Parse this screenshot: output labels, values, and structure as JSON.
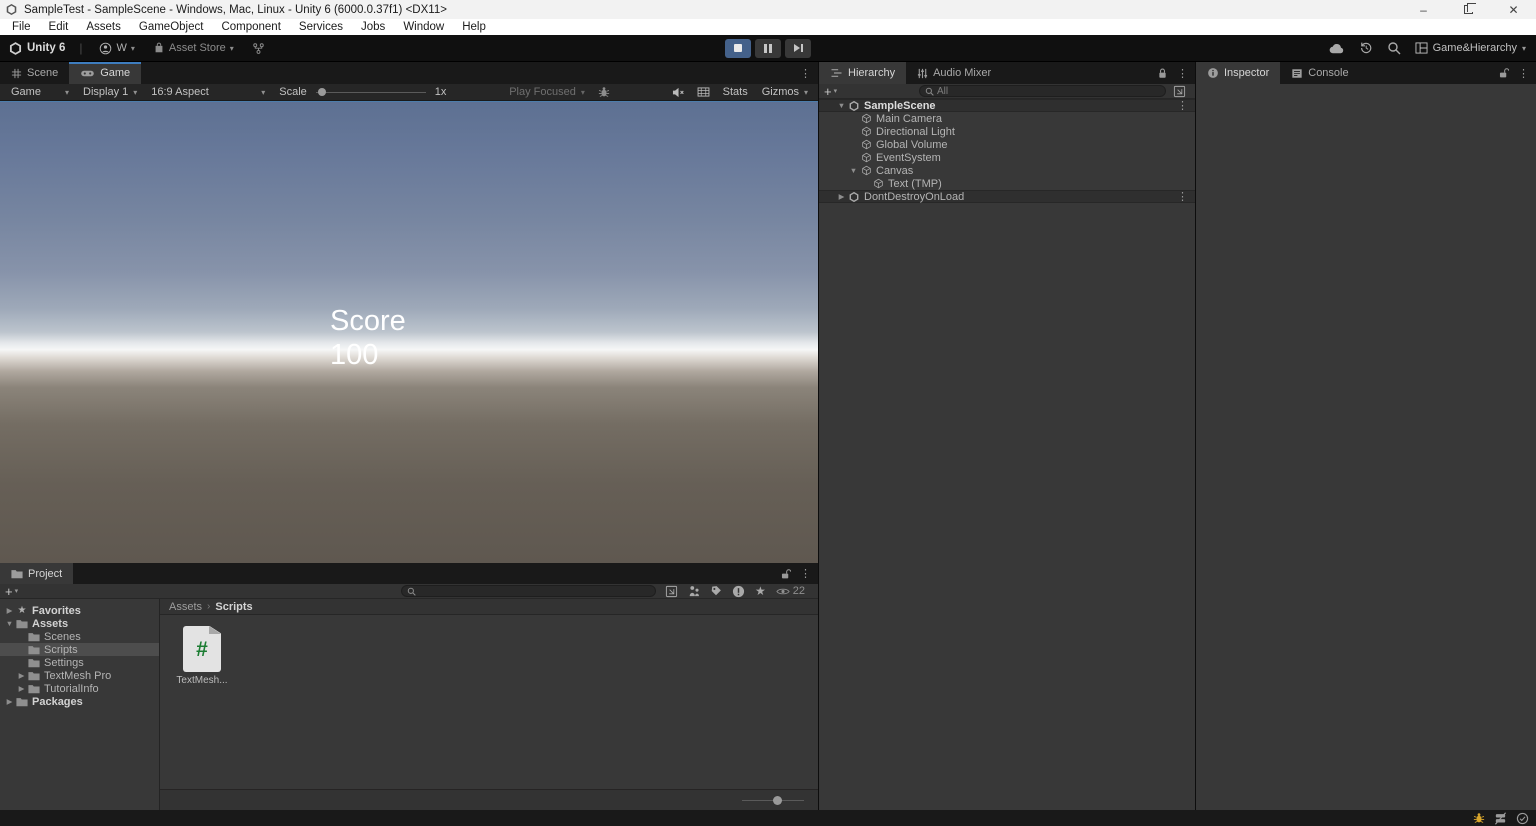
{
  "glyphs": {
    "caret": "▾",
    "expanded": "▼",
    "collapsed": "▶",
    "kebab": "⋮",
    "star": "★",
    "plus": "+",
    "crumb_sep": "›",
    "pipe": "|",
    "minimize": "–",
    "close": "✕"
  },
  "colors": {
    "tab_accent": "#3e7dbf",
    "play_active_bg": "#44618a",
    "script_green": "#1d7d33",
    "debug_yellow": "#d9a62c"
  },
  "window": {
    "title": "SampleTest - SampleScene - Windows, Mac, Linux - Unity 6 (6000.0.37f1) <DX11>"
  },
  "menu_bar": {
    "items": [
      "File",
      "Edit",
      "Assets",
      "GameObject",
      "Component",
      "Services",
      "Jobs",
      "Window",
      "Help"
    ]
  },
  "toolbar": {
    "unity_label": "Unity 6",
    "account_label": "W",
    "asset_store_label": "Asset Store",
    "layout_label": "Game&Hierarchy"
  },
  "game_panel": {
    "tabs": {
      "scene": "Scene",
      "game": "Game"
    },
    "toolbar": {
      "mode": "Game",
      "display": "Display 1",
      "aspect": "16:9 Aspect",
      "scale_label": "Scale",
      "scale_value": "1x",
      "play_focused": "Play Focused",
      "stats": "Stats",
      "gizmos": "Gizmos"
    },
    "overlay": {
      "line1": "Score",
      "line2": "100"
    }
  },
  "hierarchy_panel": {
    "tab": "Hierarchy",
    "tab2": "Audio Mixer",
    "search_placeholder": "All",
    "rows": [
      {
        "label": "SampleScene",
        "arrow": "▼",
        "kebab": "⋮",
        "classes": "depth0 scene-row bold"
      },
      {
        "label": "Main Camera",
        "arrow": "",
        "kebab": "",
        "classes": "depth1"
      },
      {
        "label": "Directional Light",
        "arrow": "",
        "kebab": "",
        "classes": "depth1"
      },
      {
        "label": "Global Volume",
        "arrow": "",
        "kebab": "",
        "classes": "depth1"
      },
      {
        "label": "EventSystem",
        "arrow": "",
        "kebab": "",
        "classes": "depth1"
      },
      {
        "label": "Canvas",
        "arrow": "▼",
        "kebab": "",
        "classes": "depth1"
      },
      {
        "label": "Text (TMP)",
        "arrow": "",
        "kebab": "",
        "classes": "depth2"
      },
      {
        "label": "DontDestroyOnLoad",
        "arrow": "▶",
        "kebab": "⋮",
        "classes": "depth0 scene-row"
      }
    ]
  },
  "inspector_panel": {
    "tab": "Inspector",
    "tab2": "Console"
  },
  "project_panel": {
    "tab": "Project",
    "breadcrumb": {
      "root": "Assets",
      "current": "Scripts"
    },
    "rows": [
      {
        "label": "Favorites",
        "arrow": "▶",
        "classes": "d0 bold fav"
      },
      {
        "label": "Assets",
        "arrow": "▼",
        "classes": "d0 bold"
      },
      {
        "label": "Scenes",
        "arrow": "",
        "classes": "d1"
      },
      {
        "label": "Scripts",
        "arrow": "",
        "classes": "d1 selected"
      },
      {
        "label": "Settings",
        "arrow": "",
        "classes": "d1"
      },
      {
        "label": "TextMesh Pro",
        "arrow": "▶",
        "classes": "d1"
      },
      {
        "label": "TutorialInfo",
        "arrow": "▶",
        "classes": "d1"
      },
      {
        "label": "Packages",
        "arrow": "▶",
        "classes": "d0 bold"
      }
    ],
    "file": {
      "label": "TextMesh...",
      "glyph": "#"
    },
    "eye_count": "22"
  }
}
